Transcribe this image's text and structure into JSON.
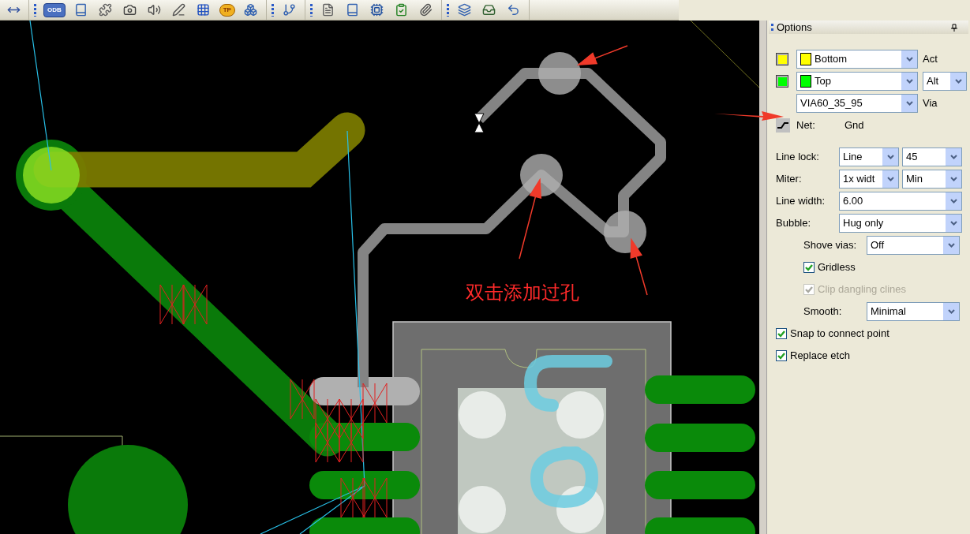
{
  "toolbar": {
    "groups": [
      {
        "items": [
          {
            "kind": "arrows"
          }
        ]
      },
      {
        "items": [
          {
            "kind": "badge",
            "label": "ODB"
          },
          {
            "kind": "book"
          },
          {
            "kind": "puzzle"
          },
          {
            "kind": "camera"
          },
          {
            "kind": "speaker"
          },
          {
            "kind": "pen"
          },
          {
            "kind": "grid"
          },
          {
            "kind": "coin",
            "label": "TP"
          },
          {
            "kind": "blocks"
          }
        ]
      },
      {
        "items": [
          {
            "kind": "branch"
          }
        ]
      },
      {
        "items": [
          {
            "kind": "doc"
          },
          {
            "kind": "book"
          },
          {
            "kind": "chip"
          },
          {
            "kind": "check"
          },
          {
            "kind": "clip"
          }
        ]
      },
      {
        "items": [
          {
            "kind": "layers"
          },
          {
            "kind": "tray"
          },
          {
            "kind": "undo"
          }
        ]
      }
    ]
  },
  "canvas": {
    "annotation": "双击添加过孔"
  },
  "options": {
    "title": "Options",
    "layers": [
      {
        "name": "Bottom",
        "color": "#ffff00",
        "role": "Act"
      },
      {
        "name": "Top",
        "color": "#00ff00",
        "alt": "Alt"
      }
    ],
    "via": {
      "value": "VIA60_35_95",
      "label": "Via"
    },
    "net": {
      "label": "Net:",
      "value": "Gnd"
    },
    "rows": [
      {
        "kind": "select",
        "label": "Line lock:",
        "values": [
          "Line",
          "45"
        ]
      },
      {
        "kind": "select",
        "label": "Miter:",
        "values": [
          "1x widt",
          "Min"
        ]
      },
      {
        "kind": "select",
        "label": "Line width:",
        "values": [
          "6.00"
        ]
      },
      {
        "kind": "select",
        "label": "Bubble:",
        "values": [
          "Hug only"
        ],
        "children": [
          {
            "kind": "select",
            "label": "Shove vias:",
            "values": [
              "Off"
            ]
          },
          {
            "kind": "checkbox",
            "label": "Gridless",
            "checked": true,
            "disabled": false
          },
          {
            "kind": "checkbox",
            "label": "Clip dangling clines",
            "checked": true,
            "disabled": true
          },
          {
            "kind": "select",
            "label": "Smooth:",
            "values": [
              "Minimal"
            ]
          }
        ]
      },
      {
        "kind": "checkbox",
        "label": "Snap to connect point",
        "checked": true,
        "disabled": false
      },
      {
        "kind": "checkbox",
        "label": "Replace etch",
        "checked": true,
        "disabled": false
      }
    ]
  }
}
